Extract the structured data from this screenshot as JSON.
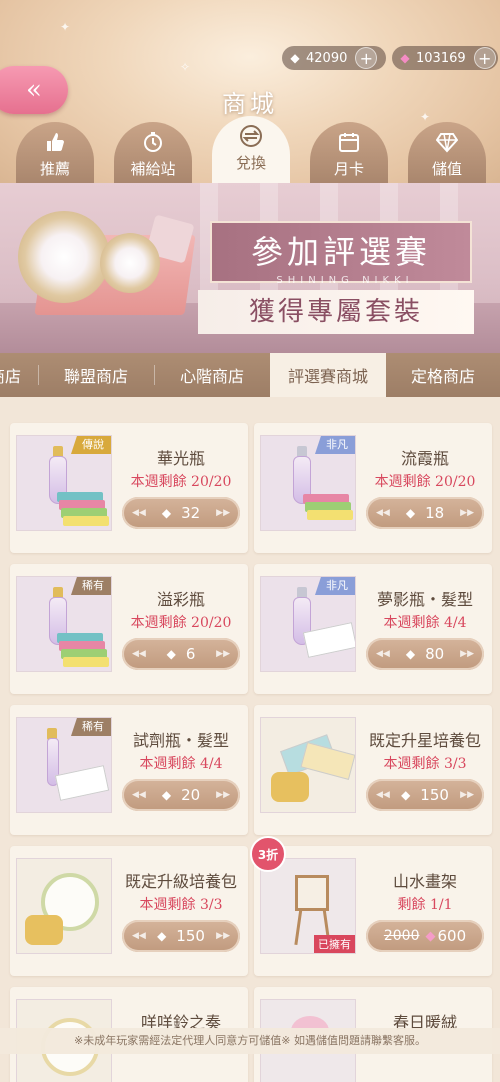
{
  "currency": {
    "stardust": {
      "icon": "diamond-white-icon",
      "value": "42090"
    },
    "diamond": {
      "icon": "diamond-pink-icon",
      "value": "103169"
    }
  },
  "header": {
    "title": "商城",
    "back_icon": "double-chevron-left-icon"
  },
  "main_tabs": [
    {
      "label": "推薦",
      "icon": "thumbs-up-icon"
    },
    {
      "label": "補給站",
      "icon": "stopwatch-icon"
    },
    {
      "label": "兌換",
      "icon": "exchange-icon",
      "active": true
    },
    {
      "label": "月卡",
      "icon": "calendar-icon"
    },
    {
      "label": "儲值",
      "icon": "gem-icon"
    }
  ],
  "banner": {
    "title": "參加評選賽",
    "subtitle_en": "SHINING NIKKI",
    "subtitle": "獲得專屬套裝"
  },
  "sub_tabs": [
    {
      "label": "商店"
    },
    {
      "label": "聯盟商店"
    },
    {
      "label": "心階商店"
    },
    {
      "label": "評選賽商城",
      "active": true
    },
    {
      "label": "定格商店"
    }
  ],
  "items": [
    {
      "name": "華光瓶",
      "stock": "本週剩餘 20/20",
      "price": "32",
      "ribbon": "傳說",
      "ribbon_color": "gold"
    },
    {
      "name": "流霞瓶",
      "stock": "本週剩餘 20/20",
      "price": "18",
      "ribbon": "非凡",
      "ribbon_color": "blue"
    },
    {
      "name": "溢彩瓶",
      "stock": "本週剩餘 20/20",
      "price": "6",
      "ribbon": "稀有",
      "ribbon_color": "brown"
    },
    {
      "name": "夢影瓶・髮型",
      "stock": "本週剩餘 4/4",
      "price": "80",
      "ribbon": "非凡",
      "ribbon_color": "blue"
    },
    {
      "name": "試劑瓶・髮型",
      "stock": "本週剩餘 4/4",
      "price": "20",
      "ribbon": "稀有",
      "ribbon_color": "brown"
    },
    {
      "name": "既定升星培養包",
      "stock": "本週剩餘 3/3",
      "price": "150"
    },
    {
      "name": "既定升級培養包",
      "stock": "本週剩餘 3/3",
      "price": "150"
    },
    {
      "name": "山水畫架",
      "stock": "剩餘 1/1",
      "old_price": "2000",
      "price": "600",
      "discount": "3折",
      "owned": "已擁有"
    },
    {
      "name": "咩咩鈴之奏"
    },
    {
      "name": "春日暖絨"
    }
  ],
  "footer": {
    "note": "※未成年玩家需經法定代理人同意方可儲值※ 如遇儲值問題請聯繫客服。"
  }
}
